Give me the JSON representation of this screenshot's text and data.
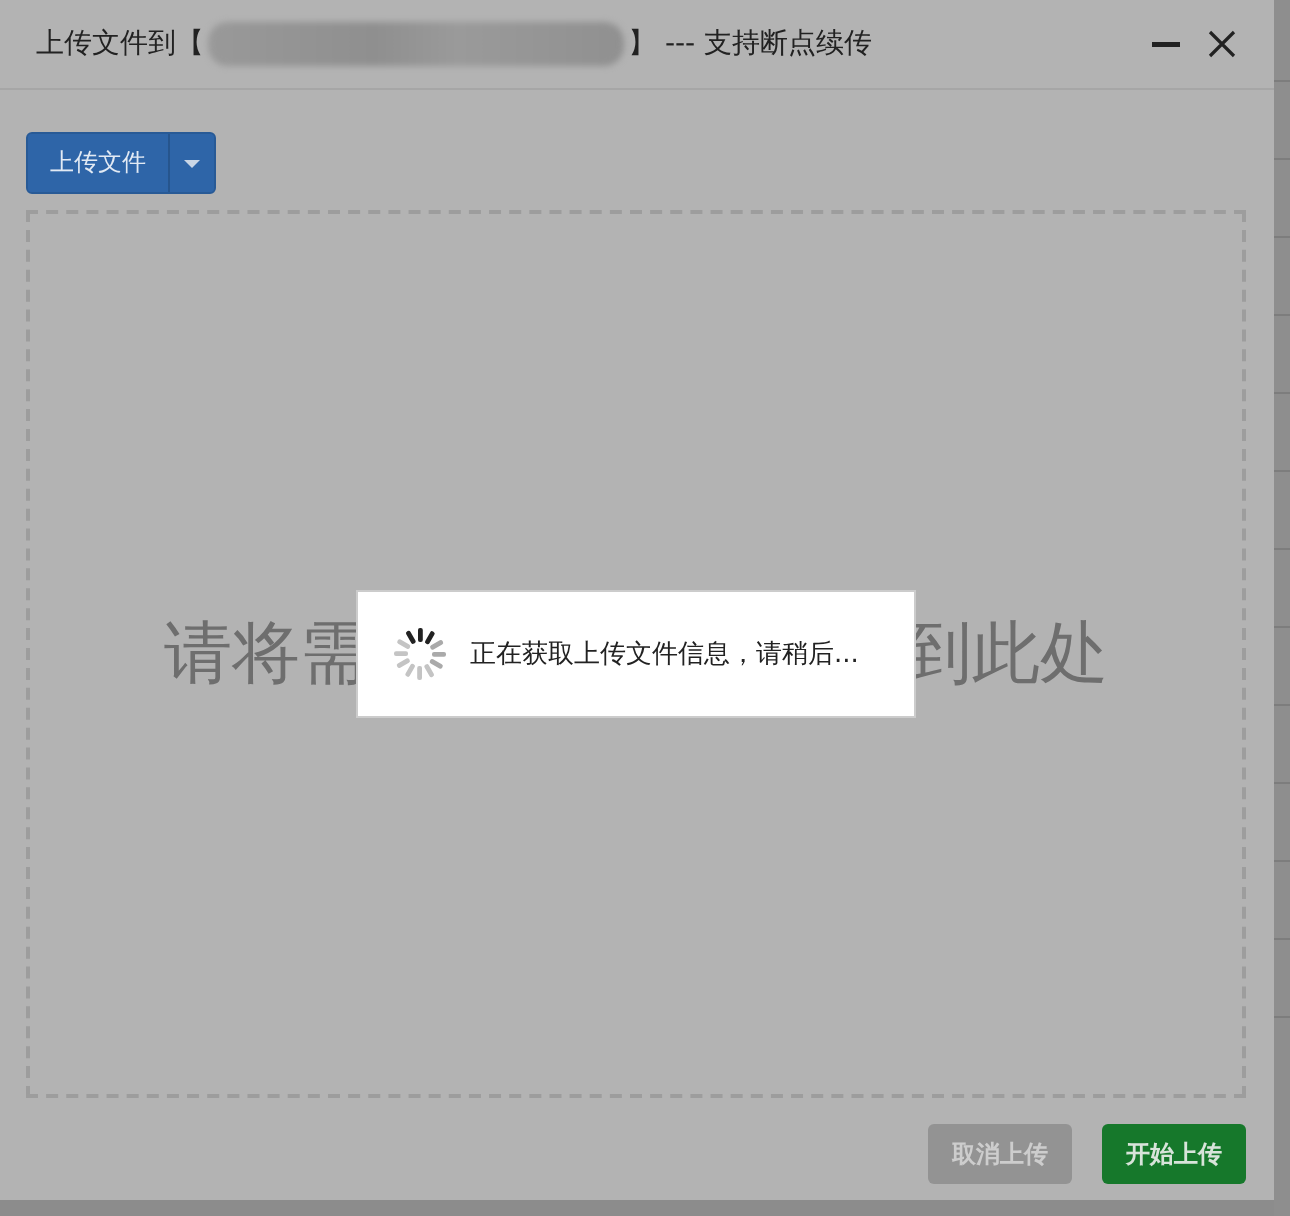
{
  "window": {
    "title_prefix": "上传文件到【",
    "title_suffix": "】 --- 支持断点续传",
    "minimize": true,
    "close": true
  },
  "toolbar": {
    "upload_button": "上传文件",
    "dropdown": true
  },
  "drop_zone": {
    "text_left": "请将需",
    "text_right": "到此处"
  },
  "loading": {
    "message": "正在获取上传文件信息，请稍后..."
  },
  "buttons": [
    {
      "label": "取消上传",
      "disabled": true
    },
    {
      "label": "开始上传",
      "disabled": false
    }
  ]
}
